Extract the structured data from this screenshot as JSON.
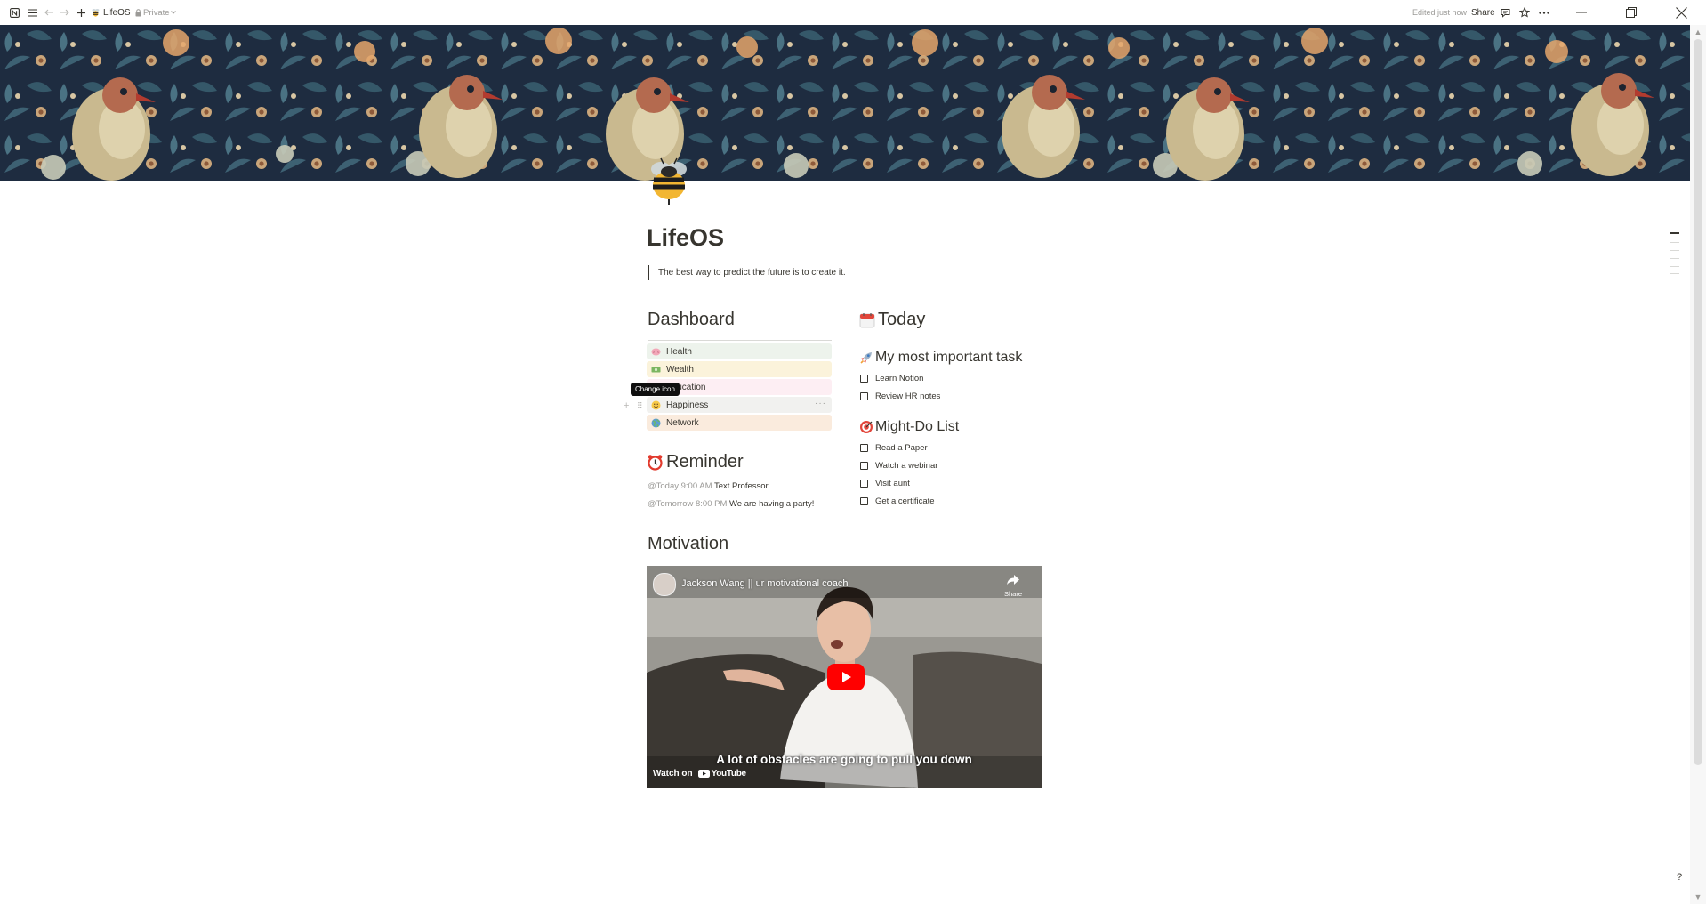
{
  "topbar": {
    "breadcrumb_title": "LifeOS",
    "visibility": "Private",
    "edited_status": "Edited just now",
    "share_label": "Share"
  },
  "page": {
    "title": "LifeOS",
    "quote": "The best way to predict the future is to create it."
  },
  "dashboard": {
    "heading": "Dashboard",
    "items": [
      {
        "label": "Health",
        "icon": "brain-icon",
        "bg": "#edf3ec"
      },
      {
        "label": "Wealth",
        "icon": "money-icon",
        "bg": "#fbf3db"
      },
      {
        "label": "Education",
        "icon": "books-icon",
        "bg": "#fdeef3"
      },
      {
        "label": "Happiness",
        "icon": "smile-icon",
        "bg": "#f1f1ef"
      },
      {
        "label": "Network",
        "icon": "globe-icon",
        "bg": "#faebdd"
      }
    ],
    "tooltip": "Change icon",
    "more_glyph": "···"
  },
  "reminder": {
    "heading": "Reminder",
    "items": [
      {
        "mention": "@Today 9:00 AM",
        "text": "Text Professor"
      },
      {
        "mention": "@Tomorrow 8:00 PM",
        "text": "We are having a party!"
      }
    ]
  },
  "today": {
    "heading": "Today",
    "important": {
      "heading": "My most important task",
      "tasks": [
        "Learn Notion",
        "Review HR notes"
      ]
    },
    "might_do": {
      "heading": "Might-Do List",
      "tasks": [
        "Read a Paper",
        "Watch a webinar",
        "Visit aunt",
        "Get a certificate"
      ]
    }
  },
  "motivation": {
    "heading": "Motivation",
    "video": {
      "title": "Jackson Wang || ur motivational coach",
      "share_label": "Share",
      "caption": "A lot of obstacles are going to pull you down",
      "watch_on": "Watch on",
      "platform": "YouTube"
    }
  },
  "help_glyph": "?",
  "colors": {
    "text": "#37352f",
    "muted": "#9b9a97",
    "youtube_red": "#ff0000"
  }
}
